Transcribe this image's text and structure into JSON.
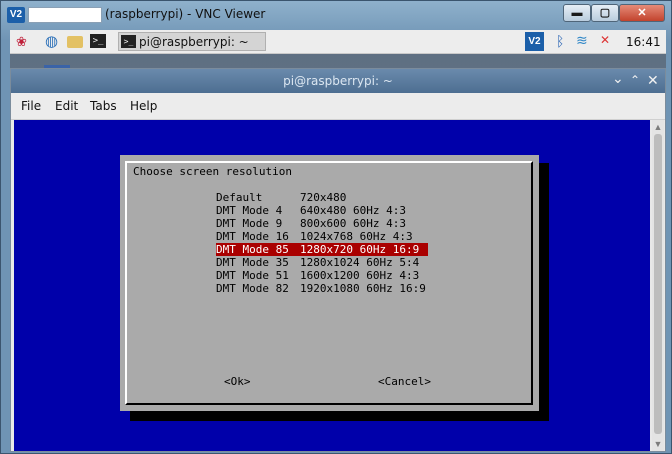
{
  "vnc_window": {
    "logo_text": "V2",
    "title": "(raspberrypi) - VNC Viewer",
    "min_glyph": "▬",
    "max_glyph": "▢",
    "close_glyph": "✕"
  },
  "panel": {
    "icons": [
      "raspberry-icon",
      "web-browser-icon",
      "file-manager-icon",
      "terminal-icon"
    ],
    "terminal_glyph": ">_",
    "task_label": "pi@raspberrypi: ~",
    "tray": {
      "vnc_text": "V2",
      "bluetooth_glyph": "ᛒ",
      "wifi_glyph": "≋",
      "volume_glyph": "✕",
      "clock": "16:41"
    }
  },
  "terminal": {
    "title": "pi@raspberrypi: ~",
    "min_glyph": "⌄",
    "max_glyph": "⌃",
    "close_glyph": "✕",
    "menu": [
      "File",
      "Edit",
      "Tabs",
      "Help"
    ],
    "colors": {
      "background": "#0000aa",
      "dialog": "#aaaaaa",
      "selected": "#aa0000"
    }
  },
  "dialog": {
    "heading": "Choose screen resolution",
    "options": [
      {
        "mode": "Default",
        "desc": "720x480",
        "selected": false
      },
      {
        "mode": "DMT Mode 4",
        "desc": "640x480 60Hz 4:3",
        "selected": false
      },
      {
        "mode": "DMT Mode 9",
        "desc": "800x600 60Hz 4:3",
        "selected": false
      },
      {
        "mode": "DMT Mode 16",
        "desc": "1024x768 60Hz 4:3",
        "selected": false
      },
      {
        "mode": "DMT Mode 85",
        "desc": "1280x720 60Hz 16:9",
        "selected": true
      },
      {
        "mode": "DMT Mode 35",
        "desc": "1280x1024 60Hz 5:4",
        "selected": false
      },
      {
        "mode": "DMT Mode 51",
        "desc": "1600x1200 60Hz 4:3",
        "selected": false
      },
      {
        "mode": "DMT Mode 82",
        "desc": "1920x1080 60Hz 16:9",
        "selected": false
      }
    ],
    "ok_label": "<Ok>",
    "cancel_label": "<Cancel>"
  }
}
